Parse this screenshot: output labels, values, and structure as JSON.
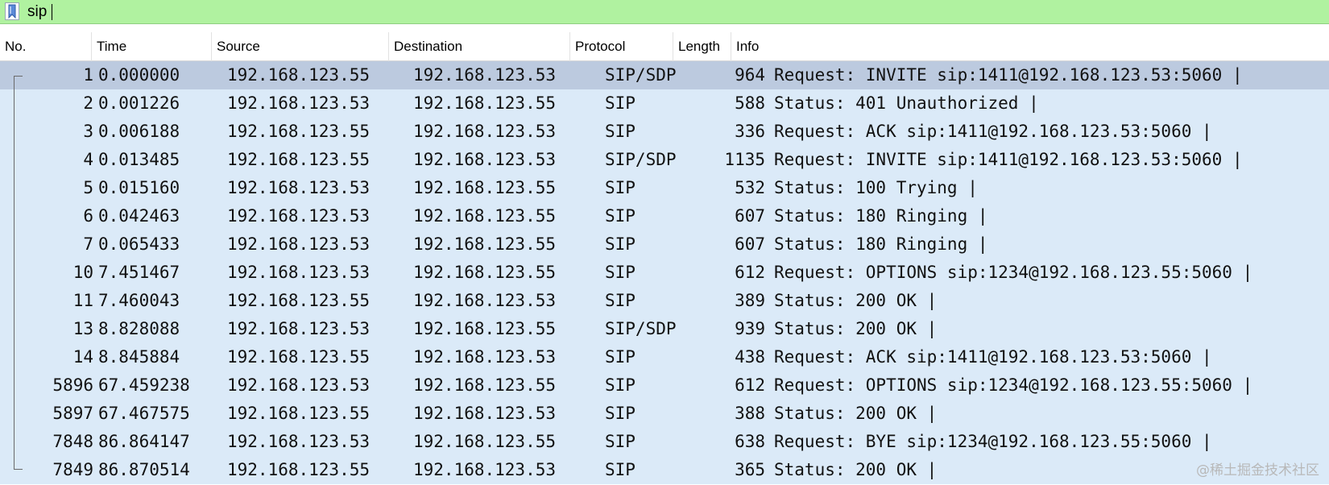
{
  "filter": {
    "value": "sip"
  },
  "columns": {
    "no": "No.",
    "time": "Time",
    "source": "Source",
    "destination": "Destination",
    "protocol": "Protocol",
    "length": "Length",
    "info": "Info"
  },
  "packets": [
    {
      "no": "1",
      "time": "0.000000",
      "source": "192.168.123.55",
      "destination": "192.168.123.53",
      "protocol": "SIP/SDP",
      "length": "964",
      "info": "Request: INVITE sip:1411@192.168.123.53:5060 |",
      "selected": true
    },
    {
      "no": "2",
      "time": "0.001226",
      "source": "192.168.123.53",
      "destination": "192.168.123.55",
      "protocol": "SIP",
      "length": "588",
      "info": "Status: 401 Unauthorized |"
    },
    {
      "no": "3",
      "time": "0.006188",
      "source": "192.168.123.55",
      "destination": "192.168.123.53",
      "protocol": "SIP",
      "length": "336",
      "info": "Request: ACK sip:1411@192.168.123.53:5060 |"
    },
    {
      "no": "4",
      "time": "0.013485",
      "source": "192.168.123.55",
      "destination": "192.168.123.53",
      "protocol": "SIP/SDP",
      "length": "1135",
      "info": "Request: INVITE sip:1411@192.168.123.53:5060 |"
    },
    {
      "no": "5",
      "time": "0.015160",
      "source": "192.168.123.53",
      "destination": "192.168.123.55",
      "protocol": "SIP",
      "length": "532",
      "info": "Status: 100 Trying |"
    },
    {
      "no": "6",
      "time": "0.042463",
      "source": "192.168.123.53",
      "destination": "192.168.123.55",
      "protocol": "SIP",
      "length": "607",
      "info": "Status: 180 Ringing |"
    },
    {
      "no": "7",
      "time": "0.065433",
      "source": "192.168.123.53",
      "destination": "192.168.123.55",
      "protocol": "SIP",
      "length": "607",
      "info": "Status: 180 Ringing |"
    },
    {
      "no": "10",
      "time": "7.451467",
      "source": "192.168.123.53",
      "destination": "192.168.123.55",
      "protocol": "SIP",
      "length": "612",
      "info": "Request: OPTIONS sip:1234@192.168.123.55:5060 |"
    },
    {
      "no": "11",
      "time": "7.460043",
      "source": "192.168.123.55",
      "destination": "192.168.123.53",
      "protocol": "SIP",
      "length": "389",
      "info": "Status: 200 OK |"
    },
    {
      "no": "13",
      "time": "8.828088",
      "source": "192.168.123.53",
      "destination": "192.168.123.55",
      "protocol": "SIP/SDP",
      "length": "939",
      "info": "Status: 200 OK |"
    },
    {
      "no": "14",
      "time": "8.845884",
      "source": "192.168.123.55",
      "destination": "192.168.123.53",
      "protocol": "SIP",
      "length": "438",
      "info": "Request: ACK sip:1411@192.168.123.53:5060 |"
    },
    {
      "no": "5896",
      "time": "67.459238",
      "source": "192.168.123.53",
      "destination": "192.168.123.55",
      "protocol": "SIP",
      "length": "612",
      "info": "Request: OPTIONS sip:1234@192.168.123.55:5060 |"
    },
    {
      "no": "5897",
      "time": "67.467575",
      "source": "192.168.123.55",
      "destination": "192.168.123.53",
      "protocol": "SIP",
      "length": "388",
      "info": "Status: 200 OK |"
    },
    {
      "no": "7848",
      "time": "86.864147",
      "source": "192.168.123.53",
      "destination": "192.168.123.55",
      "protocol": "SIP",
      "length": "638",
      "info": "Request: BYE sip:1234@192.168.123.55:5060 |"
    },
    {
      "no": "7849",
      "time": "86.870514",
      "source": "192.168.123.55",
      "destination": "192.168.123.53",
      "protocol": "SIP",
      "length": "365",
      "info": "Status: 200 OK |"
    }
  ],
  "watermark": "@稀土掘金技术社区",
  "colors": {
    "filter_valid_bg": "#b0f2a0",
    "row_bg": "#dbeaf8",
    "row_selected_bg": "#bccadf"
  },
  "icons": {
    "bookmark": "bookmark-icon"
  }
}
